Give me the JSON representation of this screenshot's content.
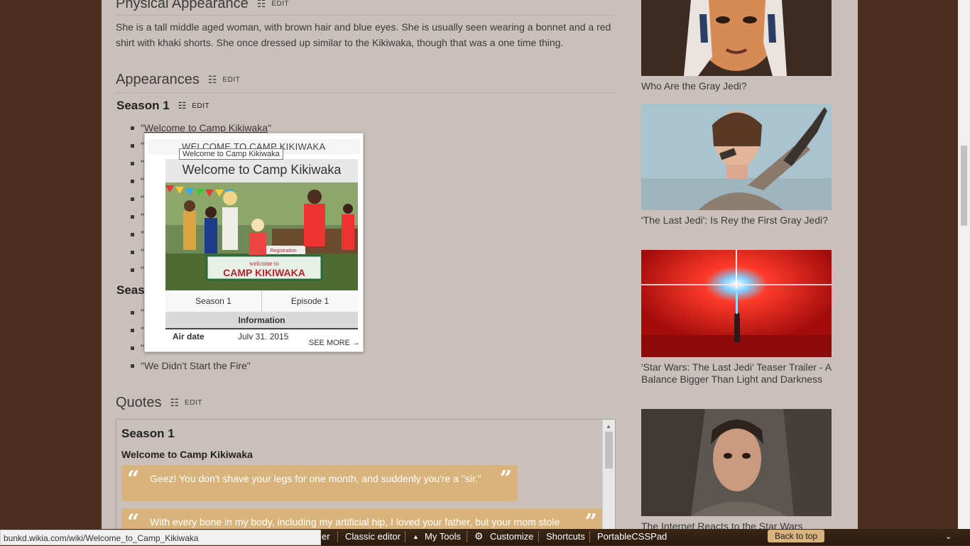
{
  "sections": {
    "physical": {
      "title": "Physical Appearance",
      "edit": "EDIT",
      "text": "She is a tall middle aged woman, with brown hair and blue eyes. She is usually seen wearing a bonnet and a red shirt with khaki shorts. She once dressed up similar to the Kikiwaka, though that was a one time thing."
    },
    "appearances": {
      "title": "Appearances",
      "edit": "EDIT"
    },
    "season1": {
      "title": "Season 1",
      "edit": "EDIT",
      "first_item": "\"Welcome to Camp Kikiwaka\"",
      "first_item_link": "Welcome to Camp Kikiwaka",
      "partial_items": [
        "\"",
        "\"",
        "\"",
        "\"",
        "\"",
        "\"",
        "\"",
        "\""
      ]
    },
    "season2": {
      "title_partial": "Seas",
      "partial_items": [
        "\"",
        "\"",
        "\""
      ],
      "last_item": "\"We Didn't Start the Fire\""
    },
    "quotes": {
      "title": "Quotes",
      "edit": "EDIT",
      "season": "Season 1",
      "episode": "Welcome to Camp Kikiwaka",
      "items": [
        "Geez! You don't shave your legs for one month, and suddenly you're a \"sir.\"",
        "With every bone in my body, including my artificial hip, I loved your father, but your mom stole"
      ]
    }
  },
  "popup": {
    "title": "WELCOME TO CAMP KIKIWAKA",
    "tooltip": "Welcome to Camp Kikiwaka",
    "infobox_title": "Welcome to Camp Kikiwaka",
    "sign_text": "welcome to CAMP KIKIWAKA",
    "registration": "Registration",
    "season": "Season 1",
    "episode": "Episode 1",
    "info_header": "Information",
    "air_label": "Air date",
    "air_value": "July 31, 2015",
    "see_more": "SEE MORE →"
  },
  "sidebar": {
    "videos": [
      "Who Are the Gray Jedi?",
      "'The Last Jedi': Is Rey the First Gray Jedi?",
      "'Star Wars: The Last Jedi' Teaser Trailer - A Balance Bigger Than Light and Darkness",
      "The Internet Reacts to the Star Wars"
    ]
  },
  "toolbar": {
    "partial": "er",
    "classic_editor": "Classic editor",
    "my_tools": "My Tools",
    "customize": "Customize",
    "shortcuts": "Shortcuts",
    "portable": "PortableCSSPad",
    "back_to_top": "Back to top"
  },
  "status_url": "bunkd.wikia.com/wiki/Welcome_to_Camp_Kikiwaka",
  "icons": {
    "edit": "list-edit-icon",
    "gear": "gear-icon",
    "caret": "caret-up-icon",
    "collapse": "double-chevron-down-icon"
  }
}
